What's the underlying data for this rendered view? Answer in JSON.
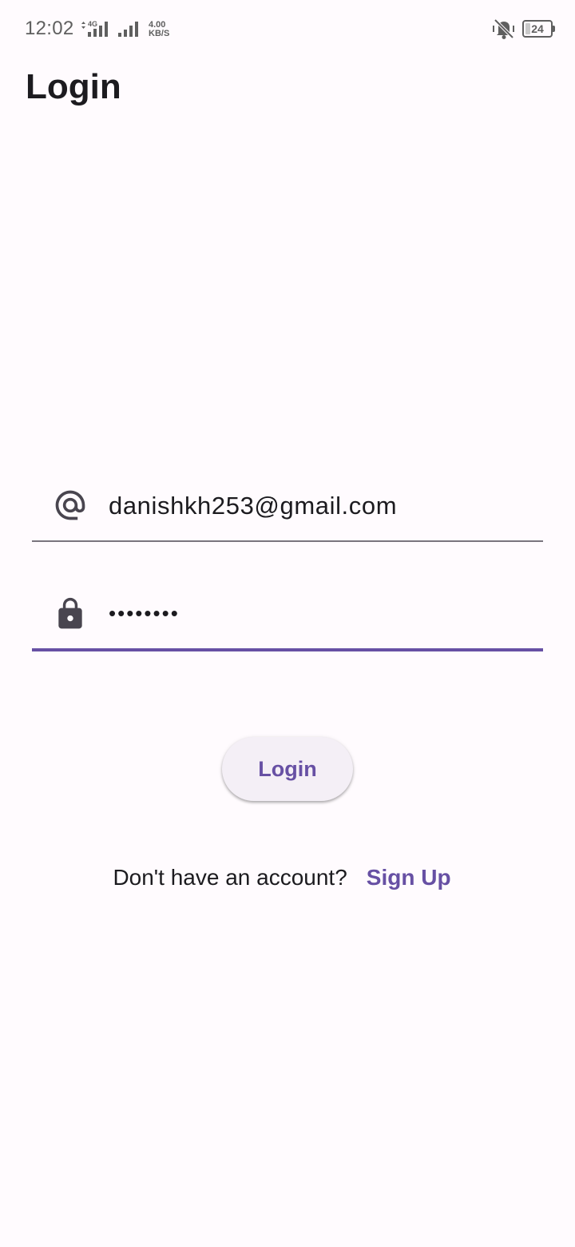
{
  "status_bar": {
    "time": "12:02",
    "network_type": "4G",
    "speed_value": "4.00",
    "speed_unit": "KB/S",
    "battery_level": "24",
    "icons": [
      "signal-4g-icon",
      "signal-bars-icon",
      "vibrate-icon",
      "battery-icon"
    ]
  },
  "header": {
    "title": "Login"
  },
  "form": {
    "email": {
      "icon": "at-icon",
      "value": "danishkh253@gmail.com"
    },
    "password": {
      "icon": "lock-icon",
      "value": "••••••••"
    },
    "login_button_label": "Login"
  },
  "footer": {
    "prompt_text": "Don't have an account?",
    "signup_link_label": "Sign Up"
  },
  "colors": {
    "background": "#fffbfe",
    "accent": "#6750a4",
    "text": "#1c1b1f",
    "outline": "#79747e",
    "button_surface": "#f4eff6"
  }
}
